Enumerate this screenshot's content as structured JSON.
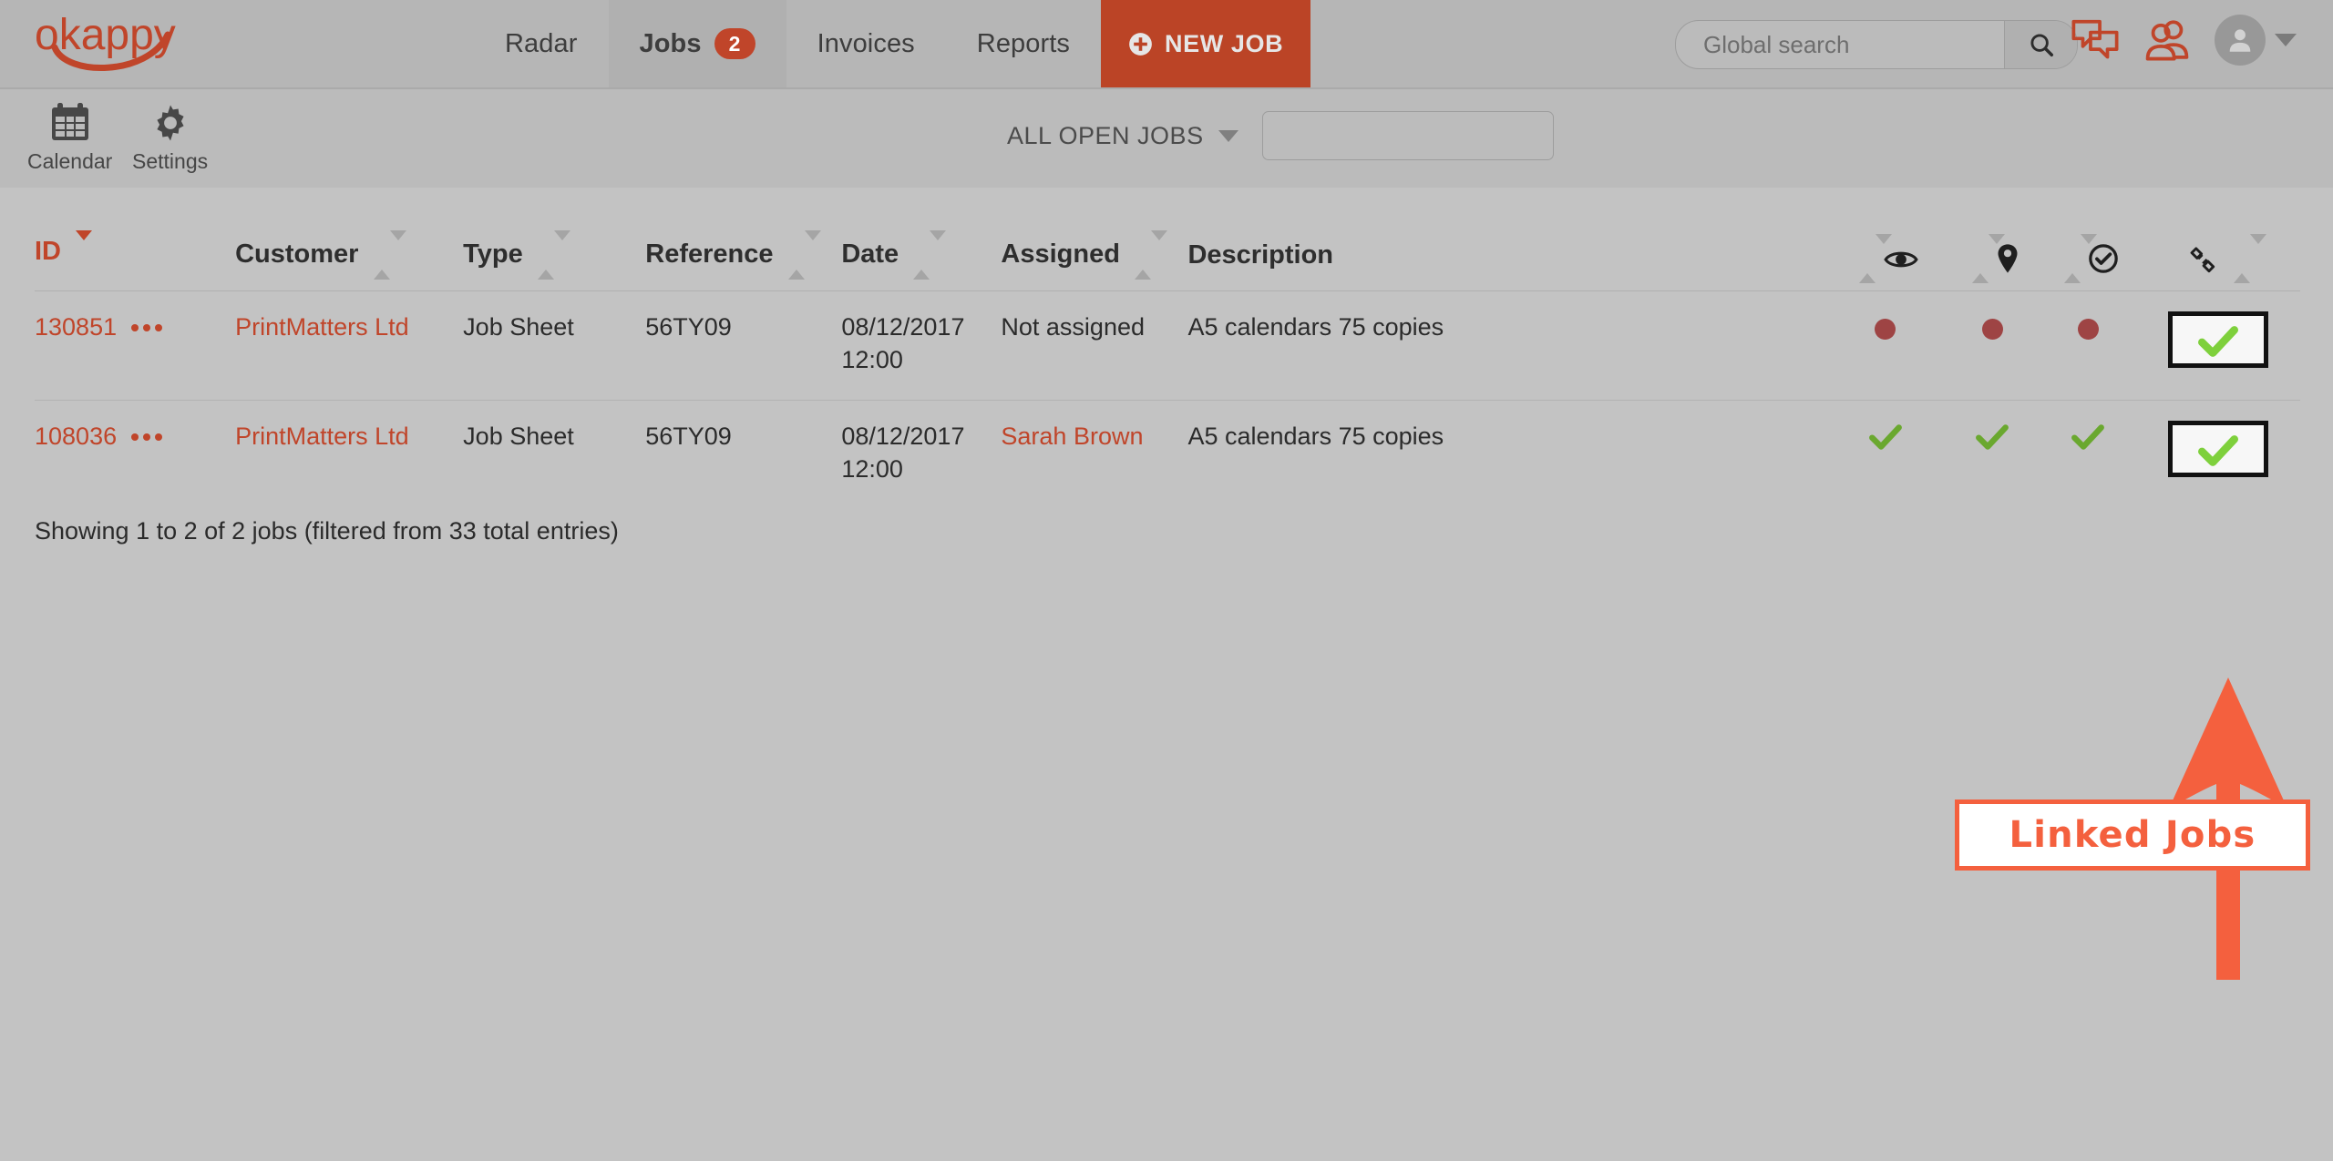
{
  "header": {
    "logo_text": "okappy",
    "nav": [
      {
        "label": "Radar",
        "active": false,
        "badge": null
      },
      {
        "label": "Jobs",
        "active": true,
        "badge": "2"
      },
      {
        "label": "Invoices",
        "active": false,
        "badge": null
      },
      {
        "label": "Reports",
        "active": false,
        "badge": null
      }
    ],
    "new_job_label": "NEW JOB",
    "search_placeholder": "Global search",
    "search_value": "",
    "icons": {
      "search": "search-icon",
      "messages": "chat-bubbles-icon",
      "contacts": "people-icon",
      "avatar": "user-avatar-icon",
      "caret": "chevron-down-icon",
      "plus": "plus-circle-icon"
    }
  },
  "toolbar": {
    "items": [
      {
        "label": "Calendar",
        "icon": "calendar-icon"
      },
      {
        "label": "Settings",
        "icon": "gear-icon"
      }
    ],
    "filter_label": "ALL OPEN JOBS",
    "filter_search_value": "",
    "filter_search_placeholder": ""
  },
  "table": {
    "columns": [
      {
        "key": "id",
        "label": "ID",
        "sorted": true,
        "sort_dir": "desc"
      },
      {
        "key": "customer",
        "label": "Customer",
        "sorted": false
      },
      {
        "key": "type",
        "label": "Type",
        "sorted": false
      },
      {
        "key": "reference",
        "label": "Reference",
        "sorted": false
      },
      {
        "key": "date",
        "label": "Date",
        "sorted": false
      },
      {
        "key": "assigned",
        "label": "Assigned",
        "sorted": false
      },
      {
        "key": "description",
        "label": "Description",
        "sorted": false
      }
    ],
    "icon_columns": [
      {
        "key": "viewed",
        "icon": "eye-icon"
      },
      {
        "key": "location",
        "icon": "map-pin-icon"
      },
      {
        "key": "completed",
        "icon": "check-circle-icon"
      },
      {
        "key": "linked",
        "icon": "link-chain-icon"
      }
    ],
    "rows": [
      {
        "id": "130851",
        "customer": "PrintMatters Ltd",
        "type": "Job Sheet",
        "reference": "56TY09",
        "date": "08/12/2017",
        "time": "12:00",
        "assigned": "Not assigned",
        "assigned_is_link": false,
        "description": "A5 calendars 75 copies",
        "status": {
          "viewed": "dot",
          "location": "dot",
          "completed": "dot",
          "linked": "tick"
        },
        "linked_highlighted": true
      },
      {
        "id": "108036",
        "customer": "PrintMatters Ltd",
        "type": "Job Sheet",
        "reference": "56TY09",
        "date": "08/12/2017",
        "time": "12:00",
        "assigned": "Sarah Brown",
        "assigned_is_link": true,
        "description": "A5 calendars 75 copies",
        "status": {
          "viewed": "tick",
          "location": "tick",
          "completed": "tick",
          "linked": "tick"
        },
        "linked_highlighted": true
      }
    ],
    "footer_text": "Showing 1 to 2 of 2 jobs (filtered from 33 total entries)"
  },
  "annotation": {
    "callout_text": "Linked Jobs",
    "arrow": "up-arrow-annotation",
    "color": "#f4603e"
  },
  "colors": {
    "brand_orange": "#c0452a",
    "annotation_orange": "#f4603e",
    "page_bg": "#c3c3c3",
    "nav_bg": "#b6b6b6",
    "status_red": "#9e4444",
    "status_green": "#6aa82f"
  }
}
